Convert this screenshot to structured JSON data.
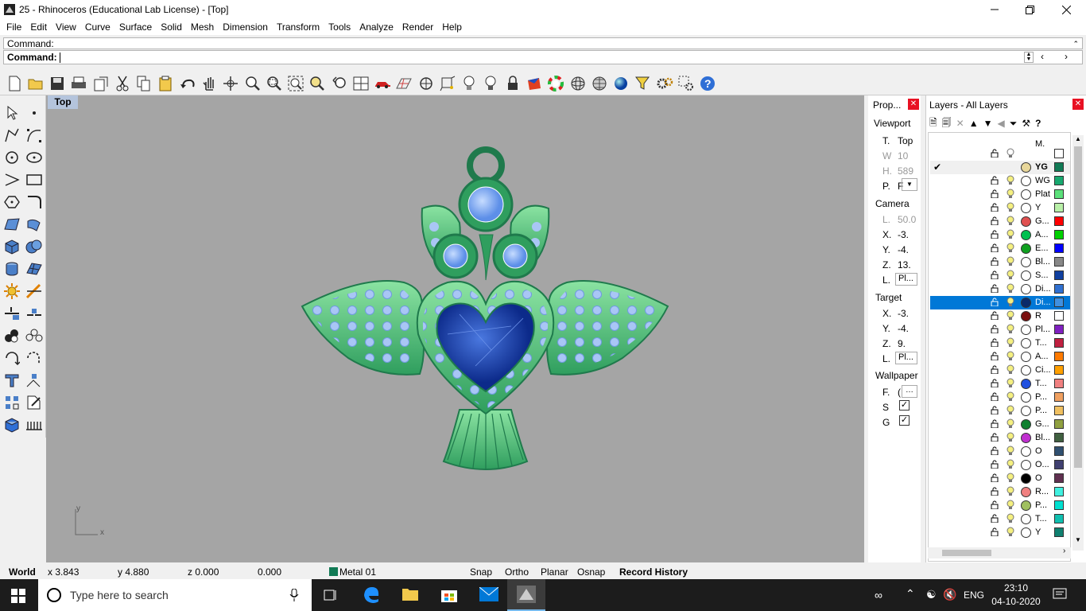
{
  "window": {
    "title": "25 - Rhinoceros (Educational Lab License) - [Top]"
  },
  "menu": [
    "File",
    "Edit",
    "View",
    "Curve",
    "Surface",
    "Solid",
    "Mesh",
    "Dimension",
    "Transform",
    "Tools",
    "Analyze",
    "Render",
    "Help"
  ],
  "command": {
    "history_label": "Command:",
    "prompt_label": "Command:"
  },
  "toolbar_icons": [
    "new-icon",
    "open-icon",
    "save-icon",
    "print-icon",
    "import-icon",
    "cut-icon",
    "copy-icon",
    "paste-icon",
    "undo-icon",
    "pan-icon",
    "rotate-view-icon",
    "zoom-window-icon",
    "zoom-dynamic-icon",
    "zoom-extents-icon",
    "zoom-selected-icon",
    "undo-view-icon",
    "four-viewports-icon",
    "car-icon",
    "grid-icon",
    "circle-icon",
    "osnap-icon",
    "light-icon",
    "bulb-icon",
    "lock-icon",
    "material-icon",
    "color-wheel-icon",
    "sphere-wire-icon",
    "sphere-grid-icon",
    "sphere-render-icon",
    "filter-icon",
    "options-icon",
    "grid-options-icon",
    "help-icon"
  ],
  "viewport": {
    "name": "Top",
    "axis_y": "y",
    "axis_x": "x"
  },
  "properties": {
    "title": "Prop...",
    "section_viewport": "Viewport",
    "title_label": "T.",
    "title_value": "Top",
    "width_label": "W",
    "width_value": "10",
    "height_label": "H.",
    "height_value": "589",
    "proj_label": "P.",
    "proj_value": "F",
    "section_camera": "Camera",
    "lens_label": "L.",
    "lens_value": "50.0",
    "cx_label": "X.",
    "cx_value": "-3.",
    "cy_label": "Y.",
    "cy_value": "-4.",
    "cz_label": "Z.",
    "cz_value": "13.",
    "loc_label": "L.",
    "loc_btn": "Pl...",
    "section_target": "Target",
    "tx_label": "X.",
    "tx_value": "-3.",
    "ty_label": "Y.",
    "ty_value": "-4.",
    "tz_label": "Z.",
    "tz_value": "9.",
    "tl_label": "L.",
    "tl_btn": "Pl...",
    "section_wallpaper": "Wallpaper",
    "wf_label": "F.",
    "wf_value": "(",
    "ws_label": "S",
    "wg_label": "G"
  },
  "layers": {
    "title": "Layers - All Layers",
    "col_m": "M.",
    "rows": [
      {
        "name": "",
        "color": "#ffffff",
        "mat": "",
        "bulb": "#ffffff"
      },
      {
        "name": "YG",
        "color": "#117a55",
        "mat": "#e8d79a",
        "bold": true,
        "current": true
      },
      {
        "name": "WG",
        "color": "#17a86f",
        "mat": "#ffffff"
      },
      {
        "name": "Plat",
        "color": "#5be07a",
        "mat": "#ffffff"
      },
      {
        "name": "Y",
        "color": "#b9f0a8",
        "mat": "#ffffff"
      },
      {
        "name": "G...",
        "color": "#ff0000",
        "mat": "#e05050"
      },
      {
        "name": "A...",
        "color": "#00d000",
        "mat": "#00c050"
      },
      {
        "name": "E...",
        "color": "#0000ff",
        "mat": "#10a020"
      },
      {
        "name": "Bl...",
        "color": "#888888",
        "mat": "#ffffff"
      },
      {
        "name": "S...",
        "color": "#1040a0",
        "mat": "#ffffff"
      },
      {
        "name": "Di...",
        "color": "#3070d0",
        "mat": "#ffffff"
      },
      {
        "name": "Di...",
        "color": "#4090e0",
        "mat": "#0a2a6a",
        "selected": true
      },
      {
        "name": "R",
        "color": "#ffffff",
        "mat": "#7a1010"
      },
      {
        "name": "Pl...",
        "color": "#8020c0",
        "mat": "#ffffff"
      },
      {
        "name": "T...",
        "color": "#c02040",
        "mat": "#ffffff"
      },
      {
        "name": "A...",
        "color": "#ff7a00",
        "mat": "#ffffff"
      },
      {
        "name": "Ci...",
        "color": "#ffa000",
        "mat": "#ffffff"
      },
      {
        "name": "T...",
        "color": "#f08080",
        "mat": "#2050e0"
      },
      {
        "name": "P...",
        "color": "#f0a060",
        "mat": "#ffffff"
      },
      {
        "name": "P...",
        "color": "#f0c060",
        "mat": "#ffffff"
      },
      {
        "name": "G...",
        "color": "#90a040",
        "mat": "#108030"
      },
      {
        "name": "Bl...",
        "color": "#406040",
        "mat": "#c030d0"
      },
      {
        "name": "O",
        "color": "#305070",
        "mat": "#ffffff"
      },
      {
        "name": "O...",
        "color": "#404070",
        "mat": "#ffffff"
      },
      {
        "name": "O",
        "color": "#603050",
        "mat": "#000000"
      },
      {
        "name": "R...",
        "color": "#40f0e0",
        "mat": "#f08080"
      },
      {
        "name": "P...",
        "color": "#00e0d0",
        "mat": "#a0c060"
      },
      {
        "name": "T...",
        "color": "#10c0b0",
        "mat": "#ffffff"
      },
      {
        "name": "Y",
        "color": "#108070",
        "mat": "#ffffff"
      }
    ]
  },
  "status": {
    "cplane": "World",
    "x": "x 3.843",
    "y": "y 4.880",
    "z": "z 0.000",
    "dist": "0.000",
    "layer": "Metal 01",
    "layer_color": "#117a55",
    "snap": "Snap",
    "ortho": "Ortho",
    "planar": "Planar",
    "osnap": "Osnap",
    "history": "Record History"
  },
  "taskbar": {
    "search_placeholder": "Type here to search",
    "lang": "ENG",
    "time": "23:10",
    "date": "04-10-2020"
  }
}
